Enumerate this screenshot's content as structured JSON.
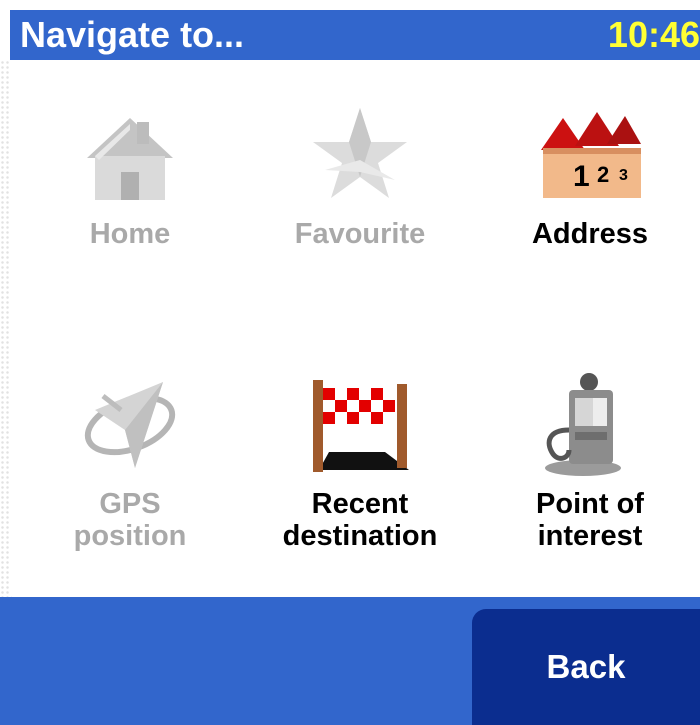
{
  "header": {
    "title": "Navigate to...",
    "time": "10:46"
  },
  "menu": {
    "items": [
      {
        "label": "Home",
        "icon": "home-icon",
        "enabled": false
      },
      {
        "label": "Favourite",
        "icon": "favourite-star-icon",
        "enabled": false
      },
      {
        "label": "Address",
        "icon": "address-houses-icon",
        "enabled": true
      },
      {
        "label_line1": "GPS",
        "label_line2": "position",
        "icon": "gps-satellite-icon",
        "enabled": false
      },
      {
        "label_line1": "Recent",
        "label_line2": "destination",
        "icon": "finish-flag-icon",
        "enabled": true
      },
      {
        "label_line1": "Point of",
        "label_line2": "interest",
        "icon": "fuel-pump-icon",
        "enabled": true
      }
    ]
  },
  "footer": {
    "back_label": "Back"
  },
  "colors": {
    "titlebar": "#3266cc",
    "clock_text": "#ffff33",
    "back_button": "#0b2d8f",
    "disabled_text": "#a9a9a9"
  }
}
